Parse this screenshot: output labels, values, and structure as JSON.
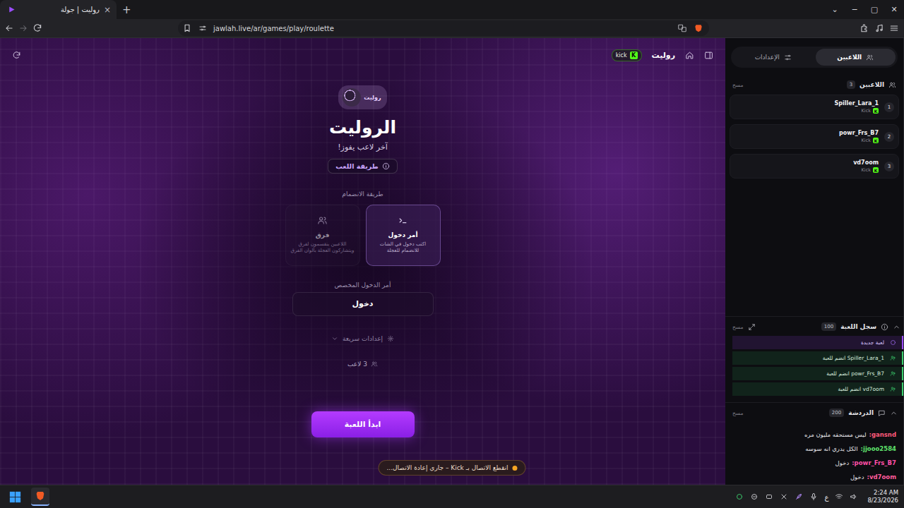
{
  "browser": {
    "tab": {
      "title": "روليت | جولة",
      "close": "×"
    },
    "new_tab": "+",
    "window_controls": [
      "⌄",
      "−",
      "▢",
      "✕"
    ],
    "url": "jawlah.live/ar/games/play/roulette"
  },
  "topbar": {
    "badge": {
      "logo": "K",
      "label": "kick"
    },
    "title": "روليت"
  },
  "game": {
    "logo_label": "روليت",
    "title": "الروليت",
    "subtitle": "آخر لاعب يفوز!",
    "how_to_play": "طريقة اللعب",
    "join_label": "طريقة الانضمام",
    "join_modes": [
      {
        "kind": "command",
        "title": "أمر دخول",
        "description": "اكتب دخول في الشات للانضمام للعجلة",
        "selected": true
      },
      {
        "kind": "teams",
        "title": "فرق",
        "description": "اللاعبين ينقسمون لفرق ويتشاركون العجلة بألوان الفرق",
        "selected": false
      }
    ],
    "command_label": "أمر الدخول المخصص",
    "command_value": "دخول",
    "quick_settings": {
      "label": "إعدادات سريعة",
      "expanded": false
    },
    "player_count": "3 لاعب",
    "start_button": "ابدأ اللعبة"
  },
  "toast": "انقطع الاتصال بـ Kick – جاري إعادة الاتصال...",
  "sidebar": {
    "tabs": [
      {
        "kind": "players",
        "label": "اللاعبين",
        "selected": true
      },
      {
        "kind": "settings",
        "label": "الإعدادات",
        "selected": false
      }
    ],
    "players": {
      "title": "اللاعبين",
      "count": "3",
      "clear": "مسح",
      "items": [
        {
          "rank": "1",
          "name": "Spiller_Lara_1",
          "platform": "Kick",
          "logo": "K"
        },
        {
          "rank": "2",
          "name": "powr_Frs_B7",
          "platform": "Kick",
          "logo": "K"
        },
        {
          "rank": "3",
          "name": "vd7oom",
          "platform": "Kick",
          "logo": "K"
        }
      ]
    },
    "log": {
      "title": "سجل اللعبة",
      "count": "100",
      "clear": "مسح",
      "entries": [
        {
          "kind": "game",
          "text": "لعبة جديدة"
        },
        {
          "kind": "join",
          "text": "Spiller_Lara_1 انضم للعبة"
        },
        {
          "kind": "join",
          "text": "powr_Frs_B7 انضم للعبة"
        },
        {
          "kind": "join",
          "text": "vd7oom انضم للعبة"
        }
      ]
    },
    "chat": {
      "title": "الدردشة",
      "count": "200",
      "clear": "مسح",
      "messages": [
        {
          "user": "gansnd:",
          "text": "ليس مستحقه مليون مره",
          "color": "#ff5a7a"
        },
        {
          "user": "jjooo2584:",
          "text": "الكل يدري انه سوسه",
          "color": "#5fe36d"
        },
        {
          "user": "powr_Frs_B7:",
          "text": "دخول",
          "color": "#ff4fa8"
        },
        {
          "user": "vd7oom:",
          "text": "دخول",
          "color": "#ff5c9d"
        }
      ]
    }
  },
  "taskbar": {
    "language": "ع",
    "time": "2:24 AM",
    "date": "8/23/2026"
  }
}
